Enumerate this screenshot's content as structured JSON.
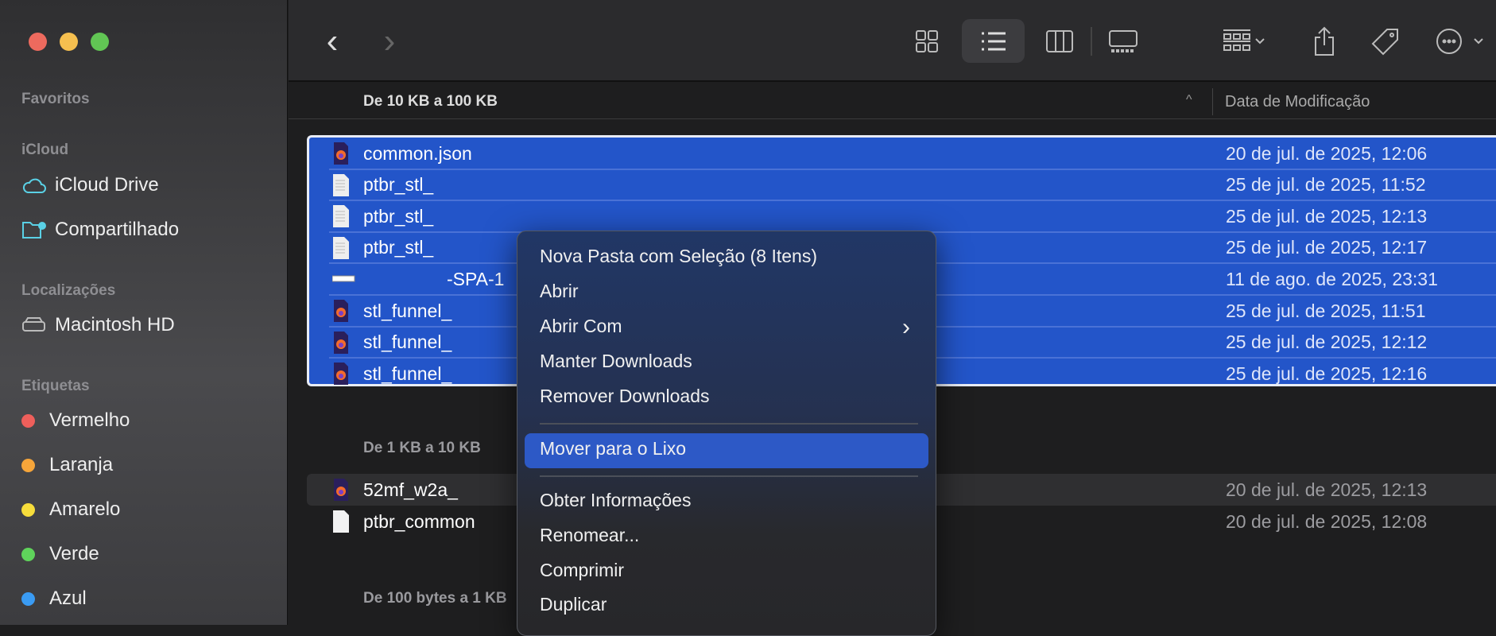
{
  "window": {
    "traffic_lights": {
      "close": "#ed6a5e",
      "minimize": "#f5bf4f",
      "zoom": "#61c554"
    }
  },
  "sidebar": {
    "favorites_heading": "Favoritos",
    "icloud_heading": "iCloud",
    "icloud_items": [
      {
        "label": "iCloud Drive",
        "icon": "cloud-icon"
      },
      {
        "label": "Compartilhado",
        "icon": "shared-folder-icon"
      }
    ],
    "locations_heading": "Localizações",
    "locations_items": [
      {
        "label": "Macintosh HD",
        "icon": "disk-icon"
      }
    ],
    "tags_heading": "Etiquetas",
    "tags": [
      {
        "label": "Vermelho",
        "color": "#ee5f5b"
      },
      {
        "label": "Laranja",
        "color": "#f6a53a"
      },
      {
        "label": "Amarelo",
        "color": "#f7dd3b"
      },
      {
        "label": "Verde",
        "color": "#5fd35b"
      },
      {
        "label": "Azul",
        "color": "#3a9bf3"
      }
    ]
  },
  "toolbar": {
    "back": "‹",
    "forward": "›",
    "active_view": "list"
  },
  "list": {
    "groups": [
      {
        "title": "De 10 KB a 100 KB",
        "rows": [
          {
            "name": "common.json",
            "date": "20 de jul. de 2025, 12:06",
            "icon": "firefox-doc-icon"
          },
          {
            "name": "ptbr_stl_",
            "date": "25 de jul. de 2025, 11:52",
            "icon": "text-doc-icon"
          },
          {
            "name": "ptbr_stl_",
            "date": "25 de jul. de 2025, 12:13",
            "icon": "text-doc-icon"
          },
          {
            "name": "ptbr_stl_",
            "date": "25 de jul. de 2025, 12:17",
            "icon": "text-doc-icon"
          },
          {
            "name": "-SPA-1",
            "date": "11 de ago. de 2025, 23:31",
            "icon": "generic-file-icon"
          },
          {
            "name": "stl_funnel_",
            "date": "25 de jul. de 2025, 11:51",
            "icon": "firefox-doc-icon"
          },
          {
            "name": "stl_funnel_",
            "date": "25 de jul. de 2025, 12:12",
            "icon": "firefox-doc-icon"
          },
          {
            "name": "stl_funnel_",
            "date": "25 de jul. de 2025, 12:16",
            "icon": "firefox-doc-icon"
          }
        ]
      },
      {
        "title": "De 1 KB a 10 KB",
        "rows": [
          {
            "name": "52mf_w2a_",
            "date": "20 de jul. de 2025, 12:13",
            "icon": "firefox-doc-icon"
          },
          {
            "name": "ptbr_common",
            "date": "20 de jul. de 2025, 12:08",
            "icon": "blank-doc-icon"
          }
        ]
      },
      {
        "title": "De 100 bytes a 1 KB",
        "rows": []
      }
    ],
    "date_column": "Data de Modificação",
    "sort_indicator": "^"
  },
  "context_menu": {
    "items": [
      "Nova Pasta com Seleção (8 Itens)",
      "Abrir",
      "Abrir Com",
      "Manter Downloads",
      "Remover Downloads",
      "Mover para o Lixo",
      "Obter Informações",
      "Renomear...",
      "Comprimir",
      "Duplicar"
    ],
    "highlighted": "Mover para o Lixo",
    "submenu_arrow": "›"
  }
}
